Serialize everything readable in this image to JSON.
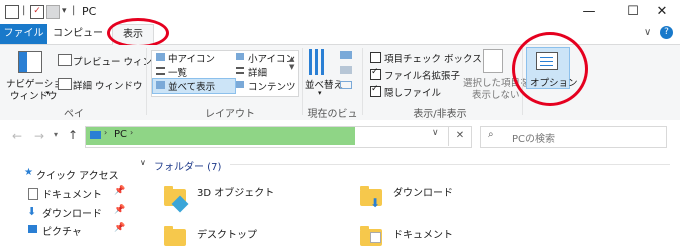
{
  "titlebar": {
    "path_label": "PC",
    "minimize": "—",
    "maximize": "☐",
    "close": "✕",
    "expand": "∨",
    "help": "?"
  },
  "tabs": [
    {
      "label": "ファイル"
    },
    {
      "label": "コンピューター"
    },
    {
      "label": "表示"
    }
  ],
  "ribbon": {
    "pane": {
      "nav_pane_label_1": "ナビゲーション",
      "nav_pane_label_2": "ウィンドウ",
      "preview_label": "プレビュー ウィンドウ",
      "details_label": "詳細 ウィンドウ",
      "group_label": "ペイン"
    },
    "layout": {
      "items": [
        "中アイコン",
        "一覧",
        "並べて表示",
        "小アイコン",
        "詳細",
        "コンテンツ"
      ],
      "group_label": "レイアウト"
    },
    "current_view": {
      "sort_label": "並べ替え",
      "group_label": "現在のビュー"
    },
    "show_hide": {
      "checkbox_item": "項目チェック ボックス",
      "extension": "ファイル名拡張子",
      "hidden": "隠しファイル",
      "hide_selected_1": "選択した項目を",
      "hide_selected_2": "表示しない",
      "group_label": "表示/非表示"
    },
    "options_label": "オプション"
  },
  "address": {
    "location": "PC",
    "search_placeholder": "PCの検索"
  },
  "nav": {
    "quick_access": "クイック アクセス",
    "items": [
      "ドキュメント",
      "ダウンロード",
      "ピクチャ"
    ]
  },
  "content": {
    "section_label": "フォルダー (7)",
    "folders": [
      "3D オブジェクト",
      "ダウンロード",
      "デスクトップ",
      "ドキュメント"
    ]
  },
  "colors": {
    "accent": "#1979ca",
    "highlight_ring": "#e5001f",
    "address_fill": "#8fd586"
  }
}
